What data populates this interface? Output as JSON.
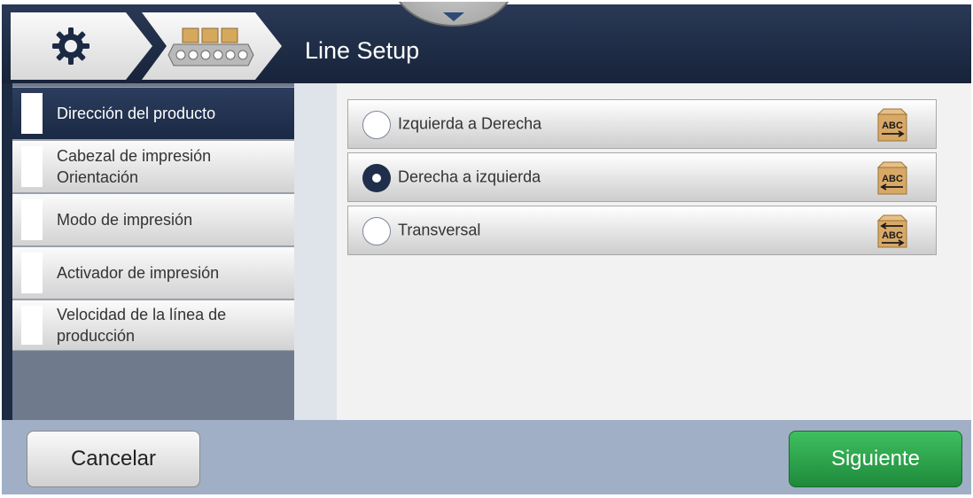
{
  "header": {
    "title": "Line Setup",
    "home_icon": "gear-icon",
    "line_icon": "conveyor-icon",
    "pull_tab_icon": "chevron-down-icon"
  },
  "sidebar": {
    "items": [
      {
        "label": "Dirección del producto",
        "active": true
      },
      {
        "label": "Cabezal de impresión\nOrientación",
        "active": false
      },
      {
        "label": "Modo de impresión",
        "active": false
      },
      {
        "label": "Activador de impresión",
        "active": false
      },
      {
        "label": "Velocidad de la línea de\nproducción",
        "active": false
      }
    ]
  },
  "options": [
    {
      "label": "Izquierda a Derecha",
      "selected": false,
      "icon": "box-arrow-right-icon",
      "box_text": "ABC"
    },
    {
      "label": "Derecha a izquierda",
      "selected": true,
      "icon": "box-arrow-left-icon",
      "box_text": "ABC"
    },
    {
      "label": "Transversal",
      "selected": false,
      "icon": "box-arrow-both-icon",
      "box_text": "ABC"
    }
  ],
  "footer": {
    "cancel_label": "Cancelar",
    "next_label": "Siguiente"
  },
  "colors": {
    "header_bg": "#1e2c45",
    "accent_green": "#2aa64b",
    "footer_bg": "#a0afc5"
  }
}
